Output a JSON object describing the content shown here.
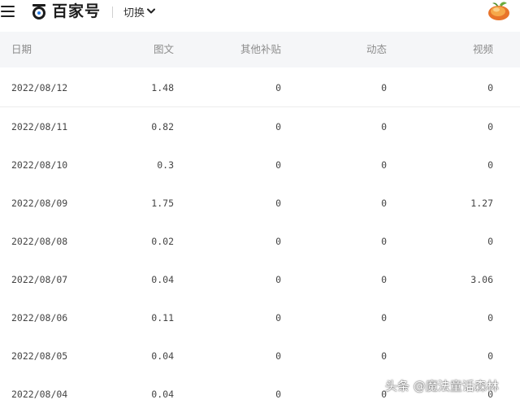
{
  "header": {
    "brand": "百家号",
    "switch_label": "切换"
  },
  "table": {
    "columns": [
      "日期",
      "图文",
      "其他补贴",
      "动态",
      "视频"
    ],
    "rows": [
      [
        "2022/08/12",
        "1.48",
        "0",
        "0",
        "0"
      ],
      [
        "2022/08/11",
        "0.82",
        "0",
        "0",
        "0"
      ],
      [
        "2022/08/10",
        "0.3",
        "0",
        "0",
        "0"
      ],
      [
        "2022/08/09",
        "1.75",
        "0",
        "0",
        "1.27"
      ],
      [
        "2022/08/08",
        "0.02",
        "0",
        "0",
        "0"
      ],
      [
        "2022/08/07",
        "0.04",
        "0",
        "0",
        "3.06"
      ],
      [
        "2022/08/06",
        "0.11",
        "0",
        "0",
        "0"
      ],
      [
        "2022/08/05",
        "0.04",
        "0",
        "0",
        "0"
      ],
      [
        "2022/08/04",
        "0.04",
        "0",
        "0",
        "0"
      ]
    ]
  },
  "watermark": "头条 @魔法童话森林",
  "icons": {
    "menu": "hamburger-menu-icon",
    "logo": "baijiahao-logo-icon",
    "dropdown": "chevron-down-icon",
    "avatar": "user-avatar"
  },
  "colors": {
    "header_background": "#f5f6f8",
    "header_text": "#8c8c8c",
    "cell_text": "#444444",
    "row_border": "#ececec"
  }
}
